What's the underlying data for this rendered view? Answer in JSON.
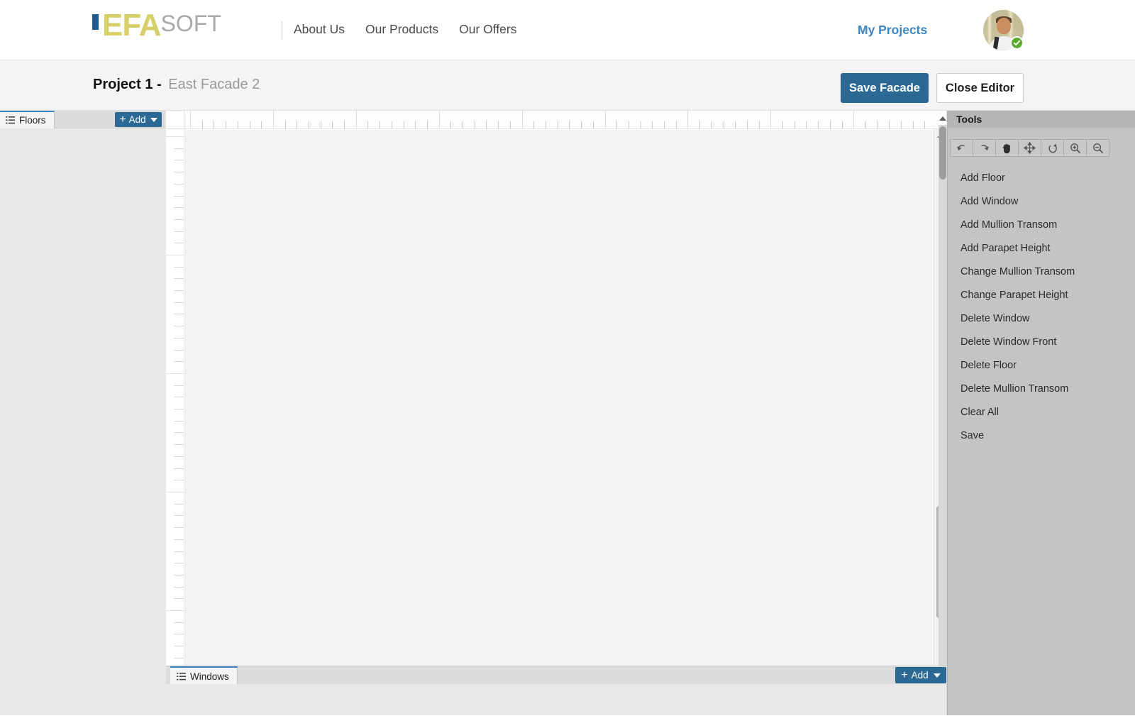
{
  "topnav": {
    "logo": {
      "bar": "|",
      "primary": "EFA",
      "secondary": "SOFT",
      "primary_color": "#d7cf67",
      "secondary_color": "#a9a9a9",
      "bar_color": "#1f5c8b"
    },
    "links": [
      {
        "label": "About Us",
        "name": "nav-about-us"
      },
      {
        "label": "Our Products",
        "name": "nav-our-products"
      },
      {
        "label": "Our Offers",
        "name": "nav-our-offers"
      }
    ],
    "my_projects_label": "My Projects",
    "my_projects_color": "#3c85c2",
    "avatar_badge_icon": "check-icon"
  },
  "projectbar": {
    "project_name": "Project 1",
    "separator": "-",
    "facade_name": "East Facade 2",
    "save_label": "Save Facade",
    "close_label": "Close Editor",
    "save_color": "#2b6894"
  },
  "floors_panel": {
    "tab_label": "Floors",
    "tab_icon": "list-icon",
    "add_label": "Add",
    "add_plus": "+",
    "add_caret_icon": "chevron-down-icon"
  },
  "windows_panel": {
    "tab_label": "Windows",
    "tab_icon": "list-icon",
    "add_label": "Add",
    "add_plus": "+",
    "add_caret_icon": "chevron-down-icon"
  },
  "canvas": {
    "ruler_top_icon": "horizontal-ruler",
    "ruler_left_icon": "vertical-ruler",
    "vscroll_up_icon": "triangle-up-icon",
    "vscroll_down_icon": "triangle-down-icon",
    "hscroll_left_icon": "triangle-left-icon",
    "hscroll_right_icon": "triangle-right-icon"
  },
  "tools_panel": {
    "title": "Tools",
    "collapse_icon": "triangle-up-icon",
    "toolbar": [
      {
        "name": "undo-icon",
        "title": "Undo"
      },
      {
        "name": "redo-icon",
        "title": "Redo"
      },
      {
        "name": "hand-pan-icon",
        "title": "Pan"
      },
      {
        "name": "move-arrows-icon",
        "title": "Move"
      },
      {
        "name": "rotate-icon",
        "title": "Rotate"
      },
      {
        "name": "zoom-in-icon",
        "title": "Zoom In"
      },
      {
        "name": "zoom-out-icon",
        "title": "Zoom Out"
      }
    ],
    "items": [
      {
        "label": "Add Floor"
      },
      {
        "label": "Add Window"
      },
      {
        "label": "Add Mullion Transom"
      },
      {
        "label": "Add Parapet Height"
      },
      {
        "label": "Change Mullion Transom"
      },
      {
        "label": "Change Parapet Height"
      },
      {
        "label": "Delete Window"
      },
      {
        "label": "Delete Window Front"
      },
      {
        "label": "Delete Floor"
      },
      {
        "label": "Delete Mullion Transom"
      },
      {
        "label": "Clear All"
      },
      {
        "label": "Save"
      }
    ]
  }
}
